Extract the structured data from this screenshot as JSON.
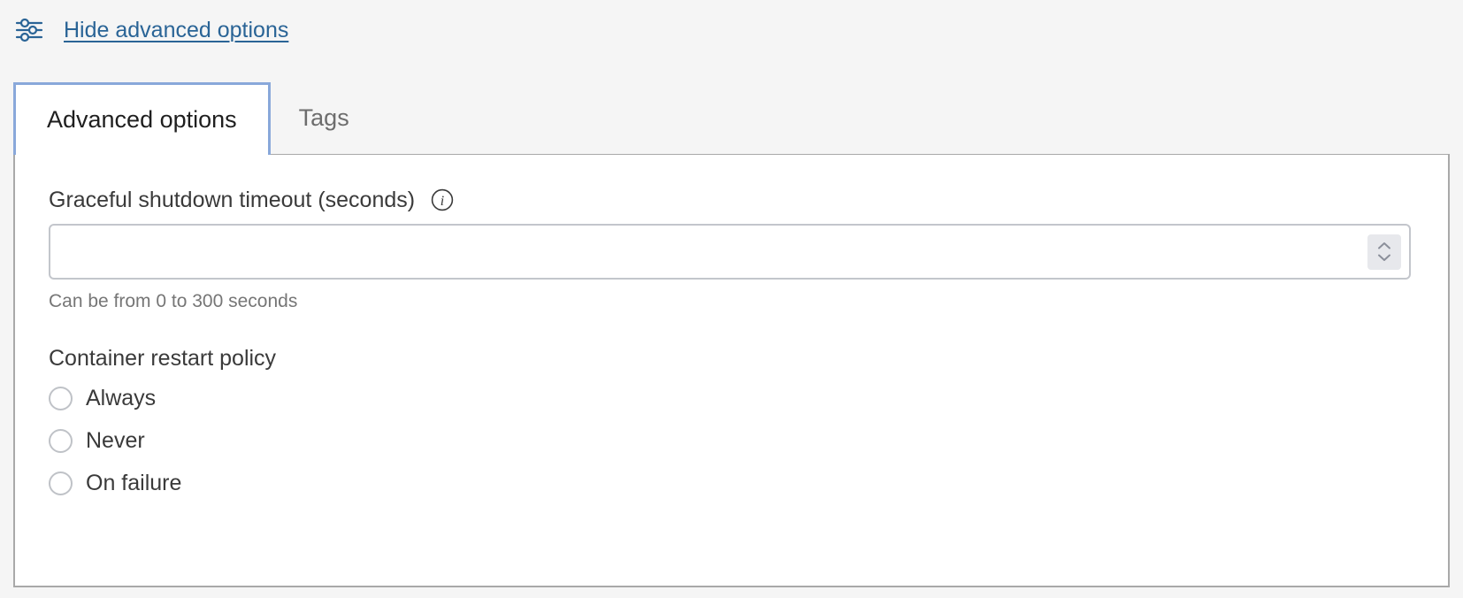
{
  "toggle": {
    "icon": "sliders-icon",
    "label": "Hide advanced options",
    "link_color": "#2a6496"
  },
  "tabs": {
    "active_index": 0,
    "active_border_color": "#89a8da",
    "items": [
      {
        "label": "Advanced options",
        "active": true
      },
      {
        "label": "Tags",
        "active": false
      }
    ]
  },
  "form": {
    "timeout": {
      "label": "Graceful shutdown timeout (seconds)",
      "info_icon": "info-circle-icon",
      "value": "",
      "placeholder": "",
      "helper_text": "Can be from 0 to 300 seconds",
      "spinner_up_icon": "chevron-up-icon",
      "spinner_down_icon": "chevron-down-icon"
    },
    "restart_policy": {
      "label": "Container restart policy",
      "selected": null,
      "options": [
        {
          "label": "Always",
          "checked": false
        },
        {
          "label": "Never",
          "checked": false
        },
        {
          "label": "On failure",
          "checked": false
        }
      ]
    }
  }
}
